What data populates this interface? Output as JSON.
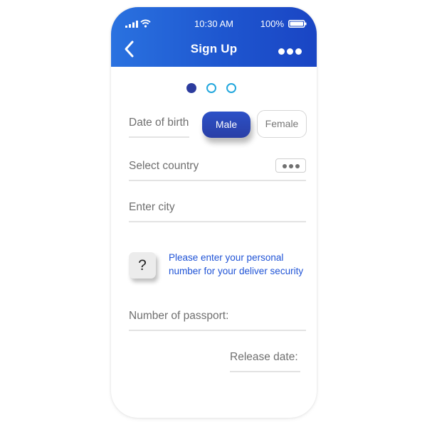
{
  "status_bar": {
    "time": "10:30 AM",
    "battery": "100%"
  },
  "header": {
    "title": "Sign Up",
    "back_icon": "chevron-left-icon",
    "more_icon": "more-dots-icon"
  },
  "steps": {
    "current": 1,
    "total": 3
  },
  "form": {
    "date_of_birth_label": "Date of birth",
    "gender": {
      "male": "Male",
      "female": "Female",
      "selected": "Male"
    },
    "country_label": "Select country",
    "city_label": "Enter city",
    "help_symbol": "?",
    "help_text": "Please enter your personal number for your deliver security",
    "passport_label": "Number of passport:",
    "release_date_label": "Release date:"
  },
  "colors": {
    "header_start": "#2a72e0",
    "header_end": "#1a45c4",
    "primary_button": "#2a3fa6",
    "step_active": "#2c3c9e",
    "step_inactive": "#22a7dd",
    "help_text": "#1f53d6"
  }
}
